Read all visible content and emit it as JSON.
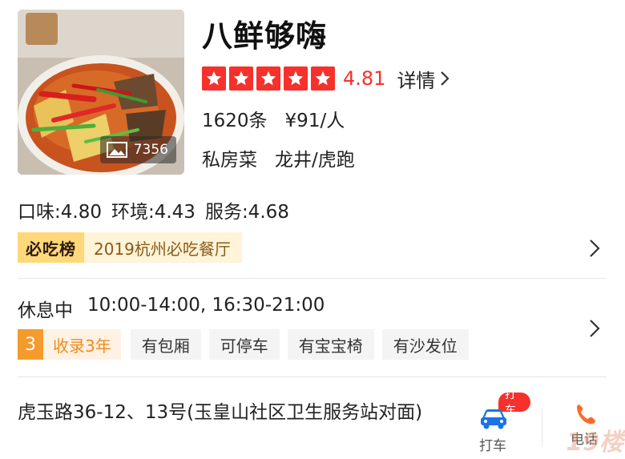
{
  "restaurant": {
    "name": "八鲜够嗨",
    "rating": "4.81",
    "detail_label": "详情",
    "review_count": "1620条",
    "price_per_person": "¥91/人",
    "cuisine": "私房菜",
    "area": "龙井/虎跑",
    "photo_count": "7356",
    "star_count": 5
  },
  "scores": {
    "taste": "口味:4.80",
    "environment": "环境:4.43",
    "service": "服务:4.68"
  },
  "ranking": {
    "logo_text": "必吃榜",
    "text": "2019杭州必吃餐厅"
  },
  "hours": {
    "status": "休息中",
    "time": "10:00-14:00, 16:30-21:00"
  },
  "listed": {
    "years_number": "3",
    "text": "收录3年"
  },
  "tags": [
    "有包厢",
    "可停车",
    "有宝宝椅",
    "有沙发位"
  ],
  "address": "虎玉路36-12、13号(玉皇山社区卫生服务站对面)",
  "actions": {
    "taxi_badge": "打车",
    "taxi_label": "打车",
    "phone_label": "电话"
  },
  "watermark": "19楼",
  "colors": {
    "star_red": "#f6312b",
    "rank_gold": "#ffd87a",
    "years_orange": "#f59a2c",
    "taxi_blue": "#1a73e8",
    "phone_orange": "#ff6a2b"
  }
}
